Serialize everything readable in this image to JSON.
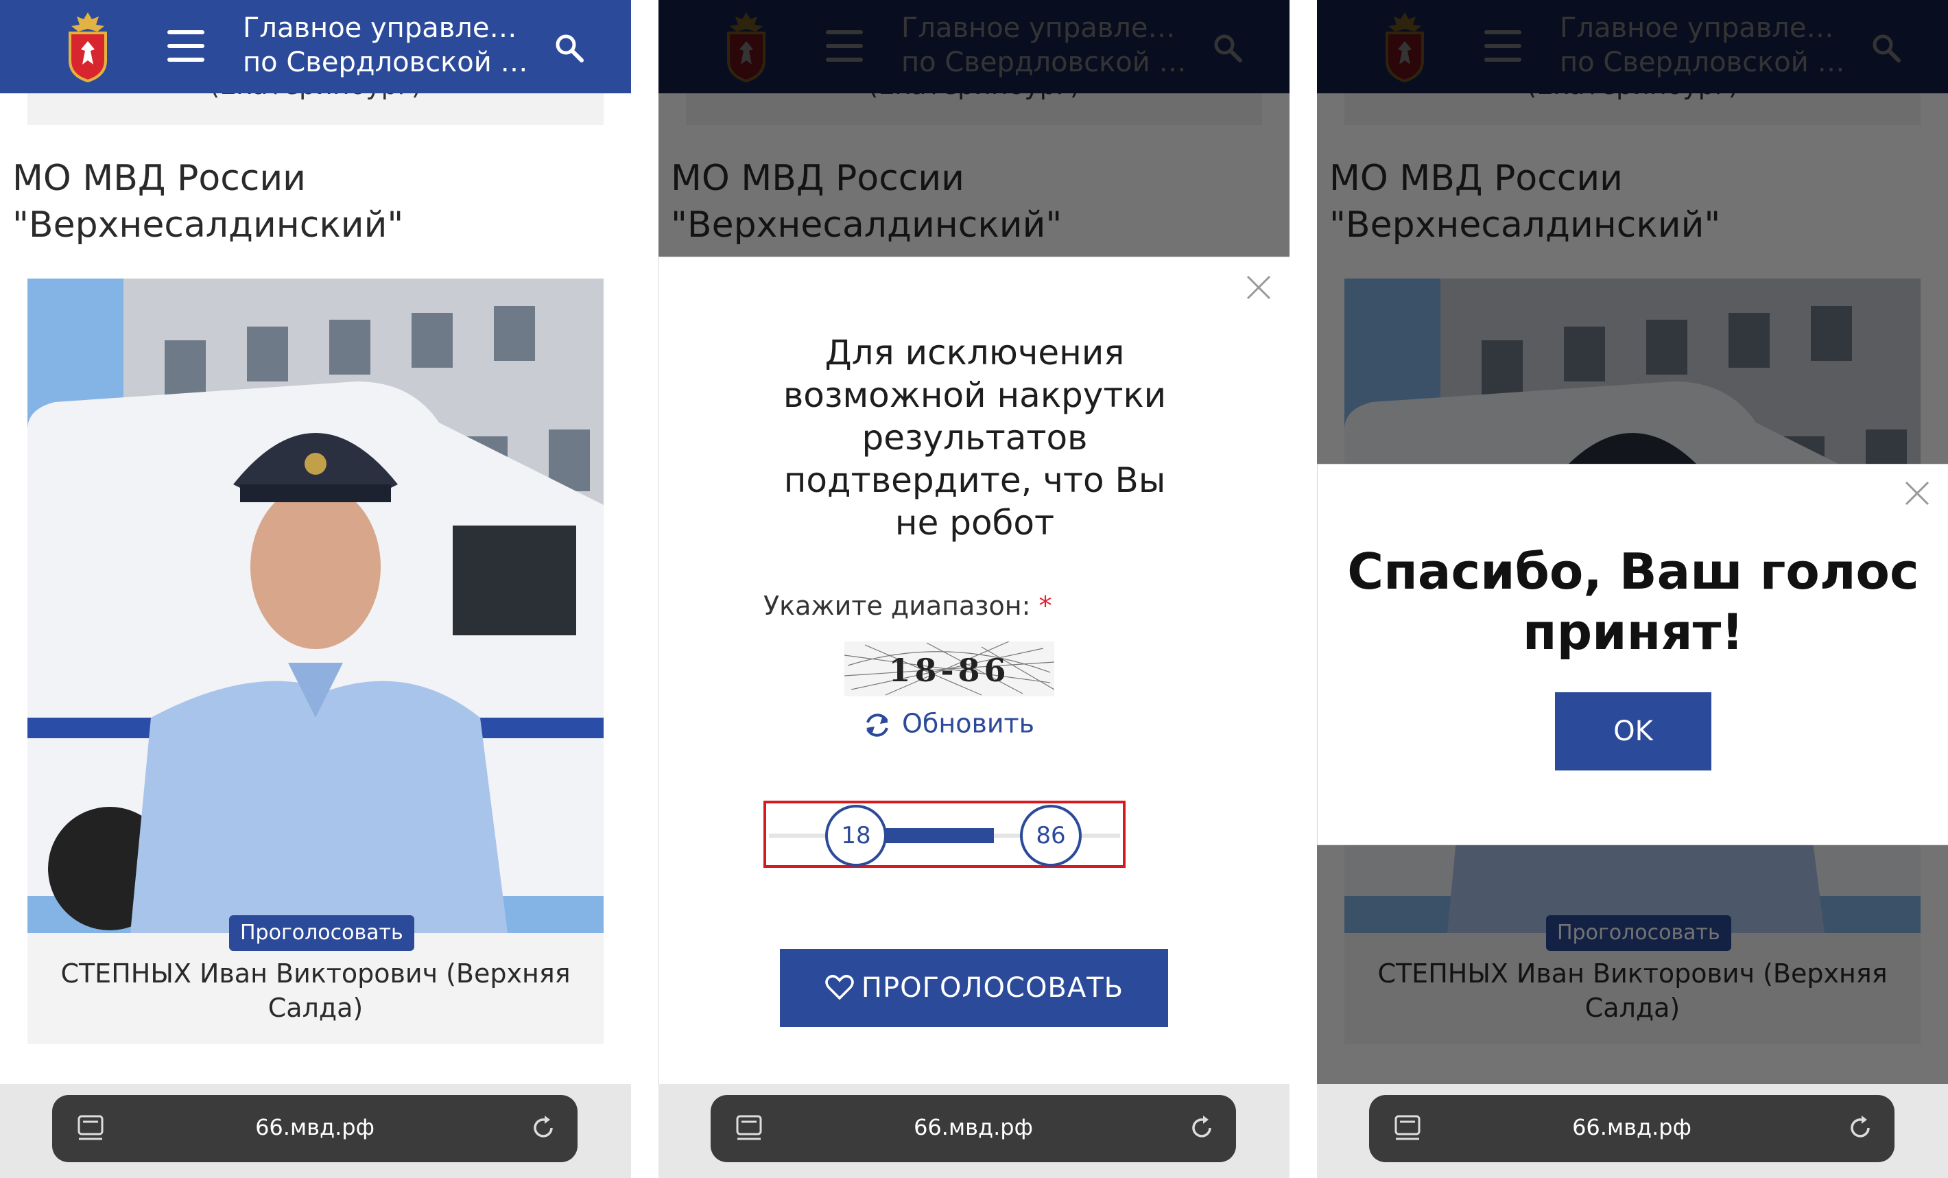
{
  "header": {
    "title_line1": "Главное управлени...",
    "title_line2": "по Свердловской о..."
  },
  "previous_card_tail": "(Екатеринбург)",
  "section_title": "МО МВД России \"Верхнесалдинский\"",
  "card": {
    "vote_badge": "Проголосовать",
    "name": "СТЕПНЫХ Иван Викторович (Верхняя Салда)"
  },
  "browser": {
    "url": "66.мвд.рф"
  },
  "captcha_modal": {
    "heading": "Для исключения возможной накрутки результатов подтвердите, что Вы не робот",
    "range_label": "Укажите диапазон:",
    "required_mark": "*",
    "captcha_text": "18-86",
    "refresh_label": "Обновить",
    "slider_min": "18",
    "slider_max": "86",
    "vote_button": "ПРОГОЛОСОВАТЬ"
  },
  "thanks_modal": {
    "message": "Спасибо, Ваш голос принят!",
    "ok_button": "OK"
  },
  "colors": {
    "header_blue": "#2c4a9a",
    "required_red": "#e0202a",
    "highlight_red": "#d71920"
  }
}
